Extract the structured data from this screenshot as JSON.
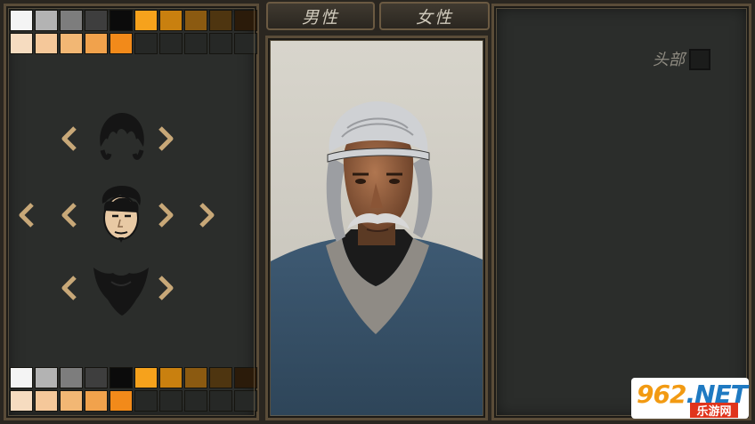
{
  "tabs": {
    "male": "男性",
    "female": "女性"
  },
  "options": {
    "head_label": "头部"
  },
  "colors": {
    "top_row1": [
      "#f4f4f4",
      "#b3b3b3",
      "#7d7d7d",
      "#3e3e3e",
      "#0b0b0b",
      "#f6a21c",
      "#c9800f",
      "#8b5a11",
      "#4e3510",
      "#2b1b0a"
    ],
    "top_row2": [
      "#f6dcc0",
      "#f5c89a",
      "#f2b774",
      "#f1a24c",
      "#f28a1a"
    ],
    "bottom_row1": [
      "#f4f4f4",
      "#b3b3b3",
      "#7d7d7d",
      "#3e3e3e",
      "#0b0b0b",
      "#f6a21c",
      "#c9800f",
      "#8b5a11",
      "#4e3510",
      "#2b1b0a"
    ],
    "bottom_row2": [
      "#f6dcc0",
      "#f5c89a",
      "#f2b774",
      "#f1a24c",
      "#f28a1a"
    ]
  },
  "selectors": [
    "hair",
    "face",
    "beard"
  ],
  "watermark": {
    "brand": "962",
    "domain": ".NET",
    "subtitle": "乐游网"
  }
}
